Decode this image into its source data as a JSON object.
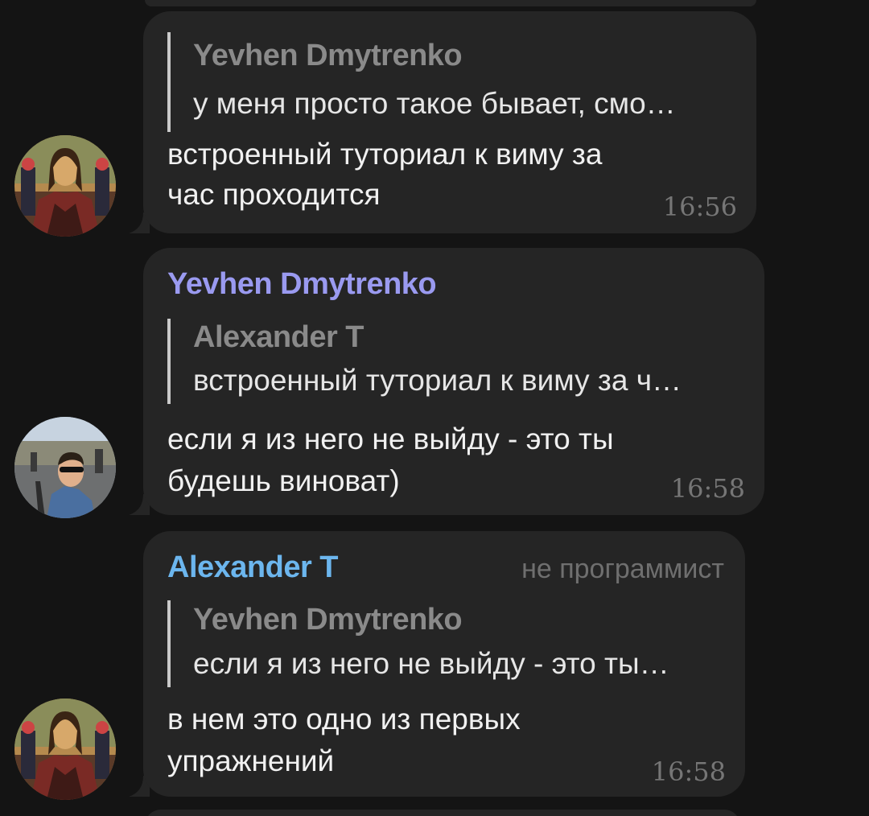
{
  "messages": [
    {
      "sender": "",
      "role": "",
      "reply_to": {
        "name": "Yevhen Dmytrenko",
        "text": "у меня просто такое бывает, смо…"
      },
      "lines": [
        "встроенный туториал к виму за",
        "час проходится"
      ],
      "time": "16:56",
      "avatar": "mona-lisa-avatar"
    },
    {
      "sender": "Yevhen Dmytrenko",
      "sender_color": "#9a9af0",
      "role": "",
      "reply_to": {
        "name": "Alexander T",
        "text": "встроенный туториал к виму за ч…"
      },
      "lines": [
        "если я из него не выйду - это ты",
        "будешь виноват)"
      ],
      "time": "16:58",
      "avatar": "selfie-photo-avatar"
    },
    {
      "sender": "Alexander T",
      "sender_color": "#6cb6ee",
      "role": "не программист",
      "reply_to": {
        "name": "Yevhen Dmytrenko",
        "text": "если я из него не выйду - это ты…"
      },
      "lines": [
        "в нем это одно из первых",
        "упражнений"
      ],
      "time": "16:58",
      "avatar": "mona-lisa-avatar"
    }
  ]
}
